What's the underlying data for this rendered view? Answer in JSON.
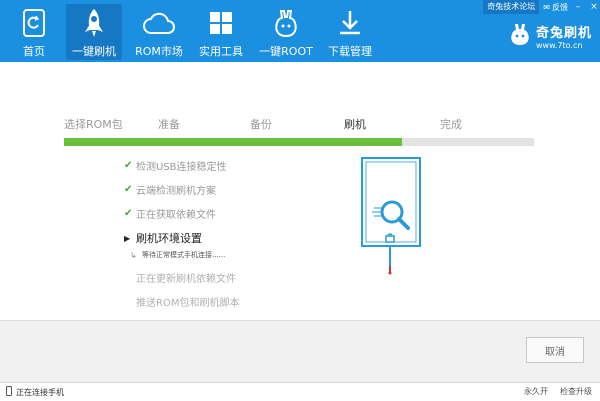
{
  "window": {
    "forum_label": "奇兔技术论坛",
    "feedback_label": "反馈",
    "minimize": "–",
    "close": "×"
  },
  "brand": {
    "name": "奇兔刷机",
    "url": "www.7to.cn"
  },
  "nav": [
    {
      "label": "首页",
      "icon": "home-icon"
    },
    {
      "label": "一键刷机",
      "icon": "rocket-icon"
    },
    {
      "label": "ROM市场",
      "icon": "cloud-icon"
    },
    {
      "label": "实用工具",
      "icon": "grid-icon"
    },
    {
      "label": "一键ROOT",
      "icon": "rabbit-icon"
    },
    {
      "label": "下载管理",
      "icon": "download-icon"
    }
  ],
  "steps": {
    "items": [
      "选择ROM包",
      "准备",
      "备份",
      "刷机",
      "完成"
    ],
    "current": "刷机",
    "progress_percent": 72
  },
  "tasks": [
    {
      "label": "检测USB连接稳定性",
      "state": "done"
    },
    {
      "label": "云端检测刷机方案",
      "state": "done"
    },
    {
      "label": "正在获取依赖文件",
      "state": "done"
    },
    {
      "label": "刷机环境设置",
      "state": "current"
    },
    {
      "label": "等待正常模式手机连接......",
      "state": "sub"
    },
    {
      "label": "正在更新刷机依赖文件",
      "state": "pending"
    },
    {
      "label": "推送ROM包和刷机脚本",
      "state": "pending"
    }
  ],
  "actions": {
    "cancel_label": "取消"
  },
  "status": {
    "connection_text": "正在连接手机",
    "right_items": [
      "永久开",
      "检查升级"
    ]
  },
  "colors": {
    "toolbar": "#1b8fe0",
    "toolbar_active": "#1677c4",
    "progress_fill": "#6cbf3d",
    "illustration": "#2a9ad8"
  }
}
